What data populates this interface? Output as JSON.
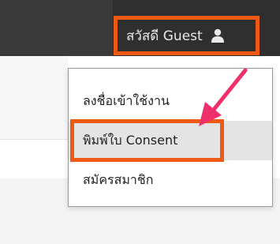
{
  "header": {
    "greeting": "สวัสดี Guest",
    "user_icon": "user-icon"
  },
  "menu": {
    "items": [
      {
        "label": "ลงชื่อเข้าใช้งาน"
      },
      {
        "label": "พิมพ์ใบ Consent"
      },
      {
        "label": "สมัครสมาชิก"
      }
    ]
  },
  "annotation": {
    "highlight_color": "#ee5a14",
    "arrow_color": "#f0306a"
  }
}
